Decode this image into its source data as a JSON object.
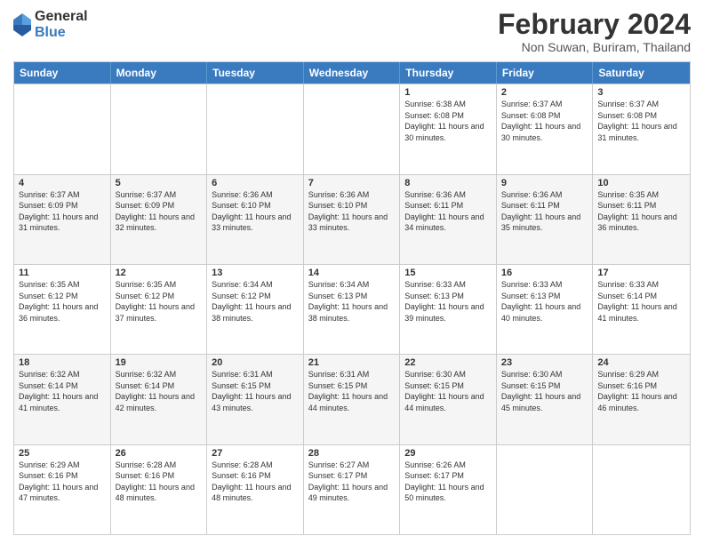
{
  "logo": {
    "general": "General",
    "blue": "Blue"
  },
  "title": "February 2024",
  "location": "Non Suwan, Buriram, Thailand",
  "days_header": [
    "Sunday",
    "Monday",
    "Tuesday",
    "Wednesday",
    "Thursday",
    "Friday",
    "Saturday"
  ],
  "weeks": [
    [
      {
        "day": "",
        "info": ""
      },
      {
        "day": "",
        "info": ""
      },
      {
        "day": "",
        "info": ""
      },
      {
        "day": "",
        "info": ""
      },
      {
        "day": "1",
        "info": "Sunrise: 6:38 AM\nSunset: 6:08 PM\nDaylight: 11 hours and 30 minutes."
      },
      {
        "day": "2",
        "info": "Sunrise: 6:37 AM\nSunset: 6:08 PM\nDaylight: 11 hours and 30 minutes."
      },
      {
        "day": "3",
        "info": "Sunrise: 6:37 AM\nSunset: 6:08 PM\nDaylight: 11 hours and 31 minutes."
      }
    ],
    [
      {
        "day": "4",
        "info": "Sunrise: 6:37 AM\nSunset: 6:09 PM\nDaylight: 11 hours and 31 minutes."
      },
      {
        "day": "5",
        "info": "Sunrise: 6:37 AM\nSunset: 6:09 PM\nDaylight: 11 hours and 32 minutes."
      },
      {
        "day": "6",
        "info": "Sunrise: 6:36 AM\nSunset: 6:10 PM\nDaylight: 11 hours and 33 minutes."
      },
      {
        "day": "7",
        "info": "Sunrise: 6:36 AM\nSunset: 6:10 PM\nDaylight: 11 hours and 33 minutes."
      },
      {
        "day": "8",
        "info": "Sunrise: 6:36 AM\nSunset: 6:11 PM\nDaylight: 11 hours and 34 minutes."
      },
      {
        "day": "9",
        "info": "Sunrise: 6:36 AM\nSunset: 6:11 PM\nDaylight: 11 hours and 35 minutes."
      },
      {
        "day": "10",
        "info": "Sunrise: 6:35 AM\nSunset: 6:11 PM\nDaylight: 11 hours and 36 minutes."
      }
    ],
    [
      {
        "day": "11",
        "info": "Sunrise: 6:35 AM\nSunset: 6:12 PM\nDaylight: 11 hours and 36 minutes."
      },
      {
        "day": "12",
        "info": "Sunrise: 6:35 AM\nSunset: 6:12 PM\nDaylight: 11 hours and 37 minutes."
      },
      {
        "day": "13",
        "info": "Sunrise: 6:34 AM\nSunset: 6:12 PM\nDaylight: 11 hours and 38 minutes."
      },
      {
        "day": "14",
        "info": "Sunrise: 6:34 AM\nSunset: 6:13 PM\nDaylight: 11 hours and 38 minutes."
      },
      {
        "day": "15",
        "info": "Sunrise: 6:33 AM\nSunset: 6:13 PM\nDaylight: 11 hours and 39 minutes."
      },
      {
        "day": "16",
        "info": "Sunrise: 6:33 AM\nSunset: 6:13 PM\nDaylight: 11 hours and 40 minutes."
      },
      {
        "day": "17",
        "info": "Sunrise: 6:33 AM\nSunset: 6:14 PM\nDaylight: 11 hours and 41 minutes."
      }
    ],
    [
      {
        "day": "18",
        "info": "Sunrise: 6:32 AM\nSunset: 6:14 PM\nDaylight: 11 hours and 41 minutes."
      },
      {
        "day": "19",
        "info": "Sunrise: 6:32 AM\nSunset: 6:14 PM\nDaylight: 11 hours and 42 minutes."
      },
      {
        "day": "20",
        "info": "Sunrise: 6:31 AM\nSunset: 6:15 PM\nDaylight: 11 hours and 43 minutes."
      },
      {
        "day": "21",
        "info": "Sunrise: 6:31 AM\nSunset: 6:15 PM\nDaylight: 11 hours and 44 minutes."
      },
      {
        "day": "22",
        "info": "Sunrise: 6:30 AM\nSunset: 6:15 PM\nDaylight: 11 hours and 44 minutes."
      },
      {
        "day": "23",
        "info": "Sunrise: 6:30 AM\nSunset: 6:15 PM\nDaylight: 11 hours and 45 minutes."
      },
      {
        "day": "24",
        "info": "Sunrise: 6:29 AM\nSunset: 6:16 PM\nDaylight: 11 hours and 46 minutes."
      }
    ],
    [
      {
        "day": "25",
        "info": "Sunrise: 6:29 AM\nSunset: 6:16 PM\nDaylight: 11 hours and 47 minutes."
      },
      {
        "day": "26",
        "info": "Sunrise: 6:28 AM\nSunset: 6:16 PM\nDaylight: 11 hours and 48 minutes."
      },
      {
        "day": "27",
        "info": "Sunrise: 6:28 AM\nSunset: 6:16 PM\nDaylight: 11 hours and 48 minutes."
      },
      {
        "day": "28",
        "info": "Sunrise: 6:27 AM\nSunset: 6:17 PM\nDaylight: 11 hours and 49 minutes."
      },
      {
        "day": "29",
        "info": "Sunrise: 6:26 AM\nSunset: 6:17 PM\nDaylight: 11 hours and 50 minutes."
      },
      {
        "day": "",
        "info": ""
      },
      {
        "day": "",
        "info": ""
      }
    ]
  ]
}
